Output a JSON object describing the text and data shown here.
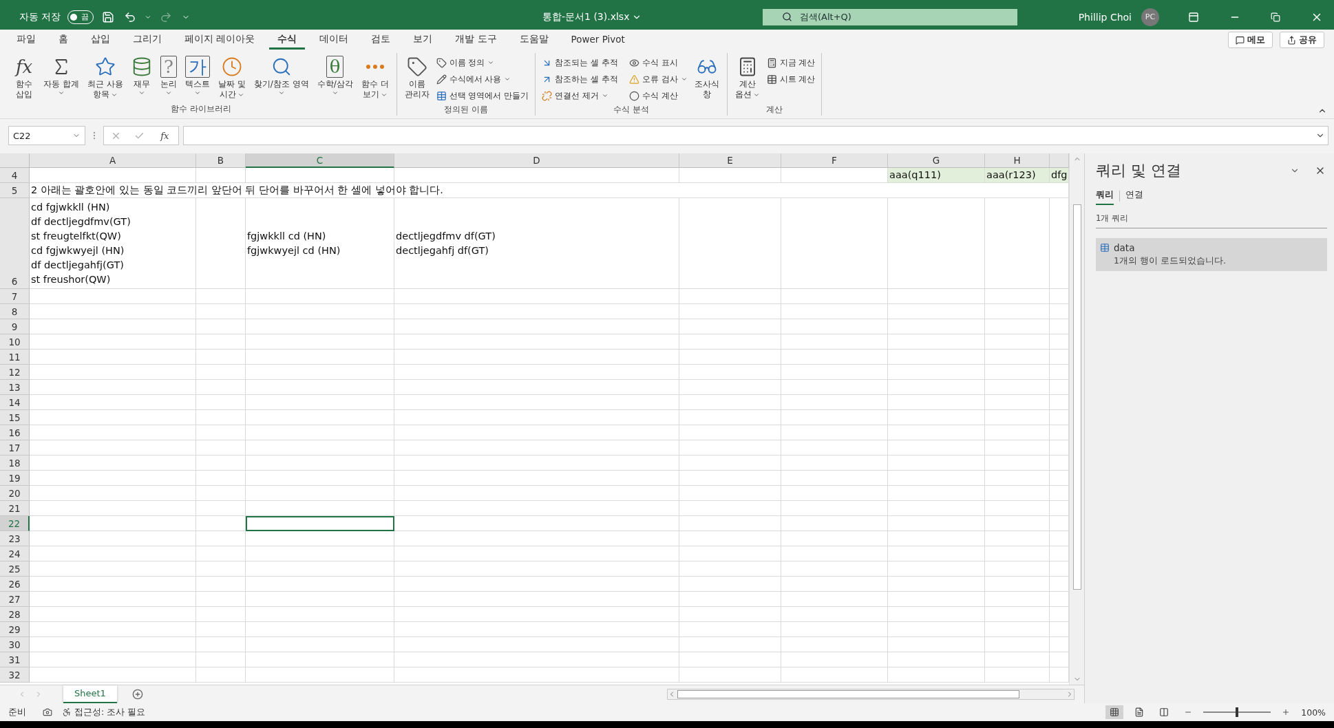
{
  "title_bar": {
    "autosave": {
      "label": "자동 저장",
      "state_label": "끔",
      "on": false
    },
    "redo": {
      "disabled": true
    },
    "filename": "통합-문서1 (3).xlsx",
    "search": {
      "placeholder": "검색(Alt+Q)"
    },
    "user": "Phillip Choi",
    "avatar": "PC"
  },
  "menu_tabs": [
    {
      "label": "파일",
      "selected": false
    },
    {
      "label": "홈",
      "selected": false
    },
    {
      "label": "삽입",
      "selected": false
    },
    {
      "label": "그리기",
      "selected": false
    },
    {
      "label": "페이지 레이아웃",
      "selected": false
    },
    {
      "label": "수식",
      "selected": true
    },
    {
      "label": "데이터",
      "selected": false
    },
    {
      "label": "검토",
      "selected": false
    },
    {
      "label": "보기",
      "selected": false
    },
    {
      "label": "개발 도구",
      "selected": false
    },
    {
      "label": "도움말",
      "selected": false
    },
    {
      "label": "Power Pivot",
      "selected": false
    }
  ],
  "ribbon_actions": [
    "메모",
    "공유"
  ],
  "ribbon_groups": [
    {
      "label": "함수 라이브러리",
      "items": [
        {
          "kind": "large",
          "glyph": "fx",
          "lines": [
            "함수",
            "삽입"
          ],
          "has_menu": false
        },
        {
          "kind": "large",
          "lines": [
            "자동 합계"
          ],
          "has_menu": true
        },
        {
          "kind": "large",
          "lines": [
            "최근 사용",
            "항목"
          ],
          "has_menu": true
        },
        {
          "kind": "large",
          "lines": [
            "재무"
          ],
          "has_menu": true
        },
        {
          "kind": "large",
          "glyph": "?",
          "lines": [
            "논리"
          ],
          "has_menu": true
        },
        {
          "kind": "large",
          "glyph": "가",
          "lines": [
            "텍스트"
          ],
          "has_menu": true
        },
        {
          "kind": "large",
          "lines": [
            "날짜 및",
            "시간"
          ],
          "has_menu": true
        },
        {
          "kind": "large",
          "lines": [
            "찾기/참조 영역"
          ],
          "has_menu": true
        },
        {
          "kind": "large",
          "glyph": "θ",
          "lines": [
            "수학/삼각"
          ],
          "has_menu": true
        },
        {
          "kind": "large",
          "lines": [
            "함수 더",
            "보기"
          ],
          "has_menu": true
        }
      ]
    },
    {
      "label": "정의된 이름",
      "items": [
        {
          "kind": "large",
          "lines": [
            "이름",
            "관리자"
          ],
          "has_menu": false
        },
        {
          "kind": "small",
          "lines": [
            "이름 정의"
          ],
          "has_menu": true
        },
        {
          "kind": "small",
          "lines": [
            "수식에서 사용"
          ],
          "has_menu": true
        },
        {
          "kind": "small",
          "lines": [
            "선택 영역에서 만들기"
          ],
          "has_menu": false
        }
      ]
    },
    {
      "label": "수식 분석",
      "items": [
        {
          "kind": "small",
          "lines": [
            "참조되는 셀 추적"
          ],
          "has_menu": false
        },
        {
          "kind": "small",
          "lines": [
            "참조하는 셀 추적"
          ],
          "has_menu": false
        },
        {
          "kind": "small",
          "lines": [
            "연결선 제거"
          ],
          "has_menu": true
        },
        {
          "kind": "small",
          "lines": [
            "수식 표시"
          ],
          "has_menu": false
        },
        {
          "kind": "small",
          "lines": [
            "오류 검사"
          ],
          "has_menu": true
        },
        {
          "kind": "small",
          "lines": [
            "수식 계산"
          ],
          "has_menu": false
        },
        {
          "kind": "large",
          "lines": [
            "조사식",
            "창"
          ],
          "has_menu": false
        }
      ]
    },
    {
      "label": "계산",
      "items": [
        {
          "kind": "large",
          "lines": [
            "계산",
            "옵션"
          ],
          "has_menu": true
        },
        {
          "kind": "small",
          "lines": [
            "지금 계산"
          ],
          "has_menu": false
        },
        {
          "kind": "small",
          "lines": [
            "시트 계산"
          ],
          "has_menu": false
        }
      ]
    }
  ],
  "formula_bar": {
    "name_box": "C22",
    "fx": "fx"
  },
  "columns": [
    {
      "label": "A",
      "selected": false
    },
    {
      "label": "B",
      "selected": false
    },
    {
      "label": "C",
      "selected": true
    },
    {
      "label": "D",
      "selected": false
    },
    {
      "label": "E",
      "selected": false
    },
    {
      "label": "F",
      "selected": false
    },
    {
      "label": "G",
      "selected": false
    },
    {
      "label": "H",
      "selected": false
    }
  ],
  "rows": [
    {
      "number": "4",
      "selected": false,
      "cells": {
        "G": {
          "lines": [
            "aaa(q111)"
          ],
          "in_table": true
        },
        "H": {
          "lines": [
            "aaa(r123)"
          ],
          "in_table": true
        },
        "I": {
          "lines": [
            "dfg"
          ],
          "in_table": true
        }
      }
    },
    {
      "number": "5",
      "selected": false,
      "cells": {
        "A": {
          "lines": [
            "2 아래는 괄호안에 있는 동일 코드끼리 앞단어 뒤 단어를 바꾸어서 한 셀에 넣어야 합니다."
          ]
        }
      }
    },
    {
      "number": "6",
      "selected": false,
      "cells": {
        "A": {
          "lines": [
            "cd fgjwkkll (HN)",
            "df dectljegdfmv(GT)",
            "st freugtelfkt(QW)",
            "cd fgjwkwyejl (HN)",
            "df dectljegahfj(GT)",
            "st freushor(QW)"
          ]
        },
        "C": {
          "lines": [
            "fgjwkkll cd (HN)",
            "fgjwkwyejl cd (HN)"
          ]
        },
        "D": {
          "lines": [
            "dectljegdfmv df(GT)",
            "dectljegahfj df(GT)"
          ]
        }
      }
    },
    {
      "number": "7",
      "selected": false
    },
    {
      "number": "8",
      "selected": false
    },
    {
      "number": "9",
      "selected": false
    },
    {
      "number": "10",
      "selected": false
    },
    {
      "number": "11",
      "selected": false
    },
    {
      "number": "12",
      "selected": false
    },
    {
      "number": "13",
      "selected": false
    },
    {
      "number": "14",
      "selected": false
    },
    {
      "number": "15",
      "selected": false
    },
    {
      "number": "16",
      "selected": false
    },
    {
      "number": "17",
      "selected": false
    },
    {
      "number": "18",
      "selected": false
    },
    {
      "number": "19",
      "selected": false
    },
    {
      "number": "20",
      "selected": false
    },
    {
      "number": "21",
      "selected": false
    },
    {
      "number": "22",
      "selected": true,
      "cells": {
        "C": {
          "selected": true
        }
      }
    },
    {
      "number": "23",
      "selected": false
    },
    {
      "number": "24",
      "selected": false
    },
    {
      "number": "25",
      "selected": false
    },
    {
      "number": "26",
      "selected": false
    },
    {
      "number": "27",
      "selected": false
    },
    {
      "number": "28",
      "selected": false
    },
    {
      "number": "29",
      "selected": false
    },
    {
      "number": "30",
      "selected": false
    },
    {
      "number": "31",
      "selected": false
    },
    {
      "number": "32",
      "selected": false
    }
  ],
  "sheet_tabs": [
    {
      "label": "Sheet1",
      "selected": true
    }
  ],
  "pane": {
    "title": "쿼리 및 연결",
    "tabs": [
      {
        "label": "쿼리",
        "selected": true
      },
      {
        "label": "연결",
        "selected": false
      }
    ],
    "count": "1개 쿼리",
    "queries": [
      {
        "name": "data",
        "status": "1개의 행이 로드되었습니다."
      }
    ]
  },
  "status_bar": {
    "ready": "준비",
    "accessibility": "접근성: 조사 필요",
    "views": [
      {
        "selected": true
      },
      {
        "selected": false
      },
      {
        "selected": false
      }
    ],
    "zoom": {
      "level": 0.5,
      "reading": "100%"
    }
  }
}
